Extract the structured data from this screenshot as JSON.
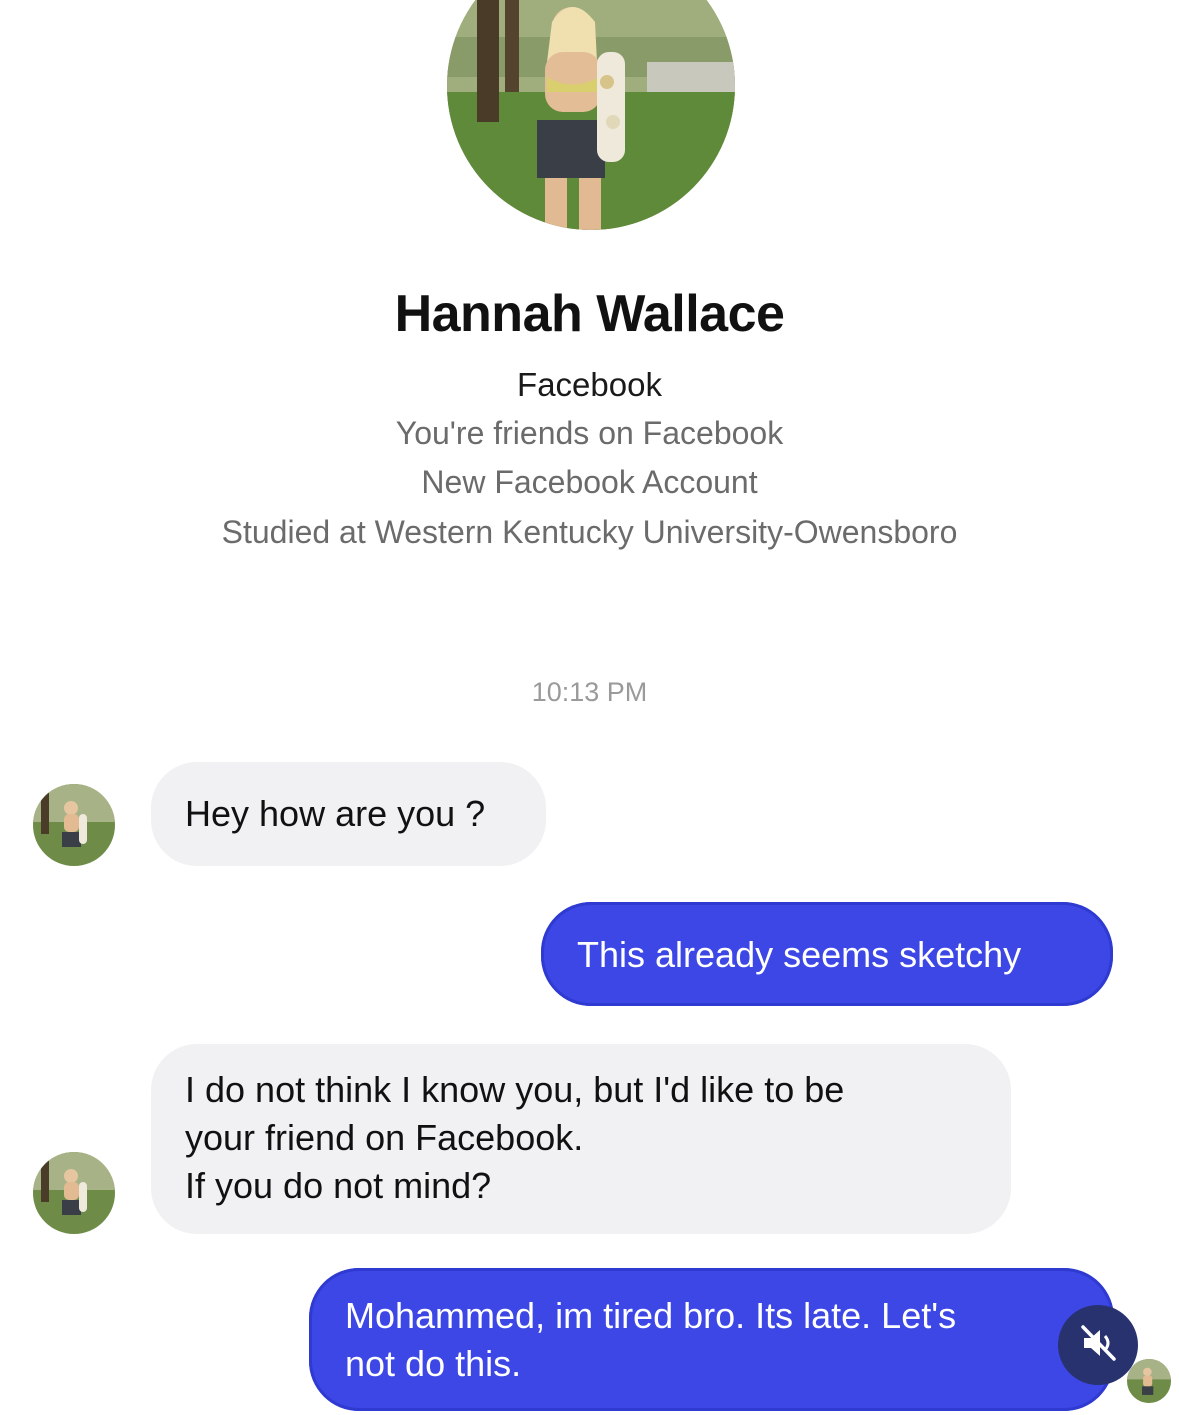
{
  "profile": {
    "name": "Hannah Wallace",
    "platform": "Facebook",
    "details": [
      "You're friends on Facebook",
      "New Facebook Account",
      "Studied at Western Kentucky University-Owensboro"
    ]
  },
  "conversation": {
    "timestamp": "10:13 PM",
    "messages": [
      {
        "direction": "incoming",
        "text": "Hey how are you ?"
      },
      {
        "direction": "outgoing",
        "text": "This already seems sketchy"
      },
      {
        "direction": "incoming",
        "lines": [
          "I do not think I know you, but I'd like to be",
          "your friend on Facebook.",
          "If you do not mind?"
        ]
      },
      {
        "direction": "outgoing",
        "lines": [
          "Mohammed, im tired bro. Its late. Let's",
          "not do this."
        ]
      }
    ]
  },
  "controls": {
    "mute_icon": "speaker-muted-icon"
  },
  "colors": {
    "outgoing_bubble": "#3c47e6",
    "incoming_bubble": "#f1f1f3",
    "secondary_text": "#6b6b6b",
    "mute_button": "#27326e"
  }
}
